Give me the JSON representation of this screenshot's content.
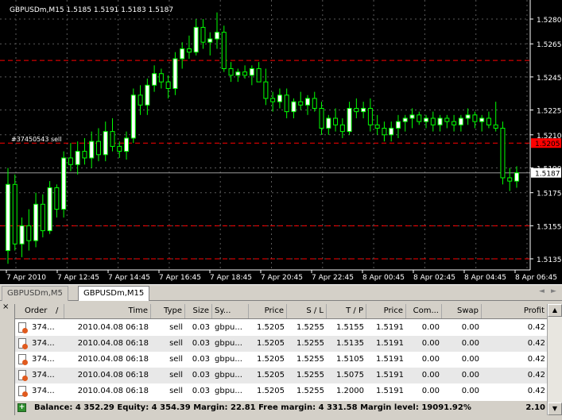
{
  "chart": {
    "header": "GBPUSDm,M15  1.5185 1.5191 1.5183 1.5187",
    "order_label": "#37450543 sell",
    "price_labels": [
      "1.5280",
      "1.5265",
      "1.5245",
      "1.5225",
      "1.5210",
      "1.5190",
      "1.5175",
      "1.5155",
      "1.5135"
    ],
    "order_price_tag": "1.5205",
    "current_price_tag": "1.5187",
    "time_labels": [
      "7 Apr 2010",
      "7 Apr 12:45",
      "7 Apr 14:45",
      "7 Apr 16:45",
      "7 Apr 18:45",
      "7 Apr 20:45",
      "7 Apr 22:45",
      "8 Apr 00:45",
      "8 Apr 02:45",
      "8 Apr 04:45",
      "8 Apr 06:45"
    ],
    "colors": {
      "background": "#000000",
      "bull": "#ffffff",
      "bear": "#000000",
      "wick": "#00ff00",
      "grid": "#5a5a5a",
      "level": "#ff0000"
    }
  },
  "tabs": [
    {
      "label": "GBPUSDm,M5",
      "active": false
    },
    {
      "label": "GBPUSDm,M15",
      "active": true
    }
  ],
  "tab_nav": {
    "left": "◄",
    "right": "►"
  },
  "terminal": {
    "close_label": "×",
    "columns": [
      "Order",
      "/",
      "Time",
      "Type",
      "Size",
      "Sy...",
      "Price",
      "S / L",
      "T / P",
      "Price",
      "Com...",
      "Swap",
      "Profit"
    ],
    "rows": [
      {
        "order": "374...",
        "time": "2010.04.08 06:18",
        "type": "sell",
        "size": "0.03",
        "symbol": "gbpu...",
        "price": "1.5205",
        "sl": "1.5255",
        "tp": "1.5155",
        "cur": "1.5191",
        "comm": "0.00",
        "swap": "0.00",
        "profit": "0.42"
      },
      {
        "order": "374...",
        "time": "2010.04.08 06:18",
        "type": "sell",
        "size": "0.03",
        "symbol": "gbpu...",
        "price": "1.5205",
        "sl": "1.5255",
        "tp": "1.5135",
        "cur": "1.5191",
        "comm": "0.00",
        "swap": "0.00",
        "profit": "0.42"
      },
      {
        "order": "374...",
        "time": "2010.04.08 06:18",
        "type": "sell",
        "size": "0.03",
        "symbol": "gbpu...",
        "price": "1.5205",
        "sl": "1.5255",
        "tp": "1.5105",
        "cur": "1.5191",
        "comm": "0.00",
        "swap": "0.00",
        "profit": "0.42"
      },
      {
        "order": "374...",
        "time": "2010.04.08 06:18",
        "type": "sell",
        "size": "0.03",
        "symbol": "gbpu...",
        "price": "1.5205",
        "sl": "1.5255",
        "tp": "1.5075",
        "cur": "1.5191",
        "comm": "0.00",
        "swap": "0.00",
        "profit": "0.42"
      },
      {
        "order": "374...",
        "time": "2010.04.08 06:18",
        "type": "sell",
        "size": "0.03",
        "symbol": "gbpu...",
        "price": "1.5205",
        "sl": "1.5255",
        "tp": "1.2000",
        "cur": "1.5191",
        "comm": "0.00",
        "swap": "0.00",
        "profit": "0.42"
      }
    ],
    "balance_text": "Balance: 4 352.29   Equity: 4 354.39   Margin: 22.81   Free margin: 4 331.58   Margin level: 19091.92%",
    "total_profit": "2.10"
  }
}
